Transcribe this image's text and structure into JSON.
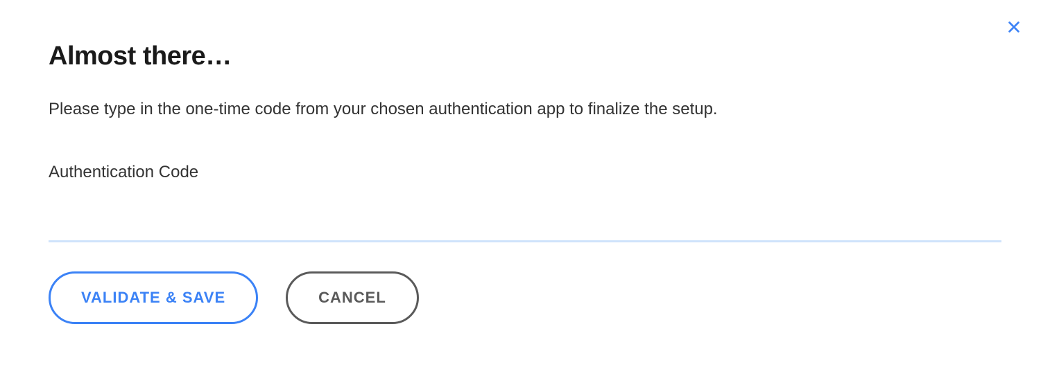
{
  "modal": {
    "title": "Almost there…",
    "description": "Please type in the one-time code from your chosen authentication app to finalize the setup.",
    "field_label": "Authentication Code",
    "field_value": "",
    "buttons": {
      "validate_label": "VALIDATE & SAVE",
      "cancel_label": "CANCEL"
    }
  }
}
